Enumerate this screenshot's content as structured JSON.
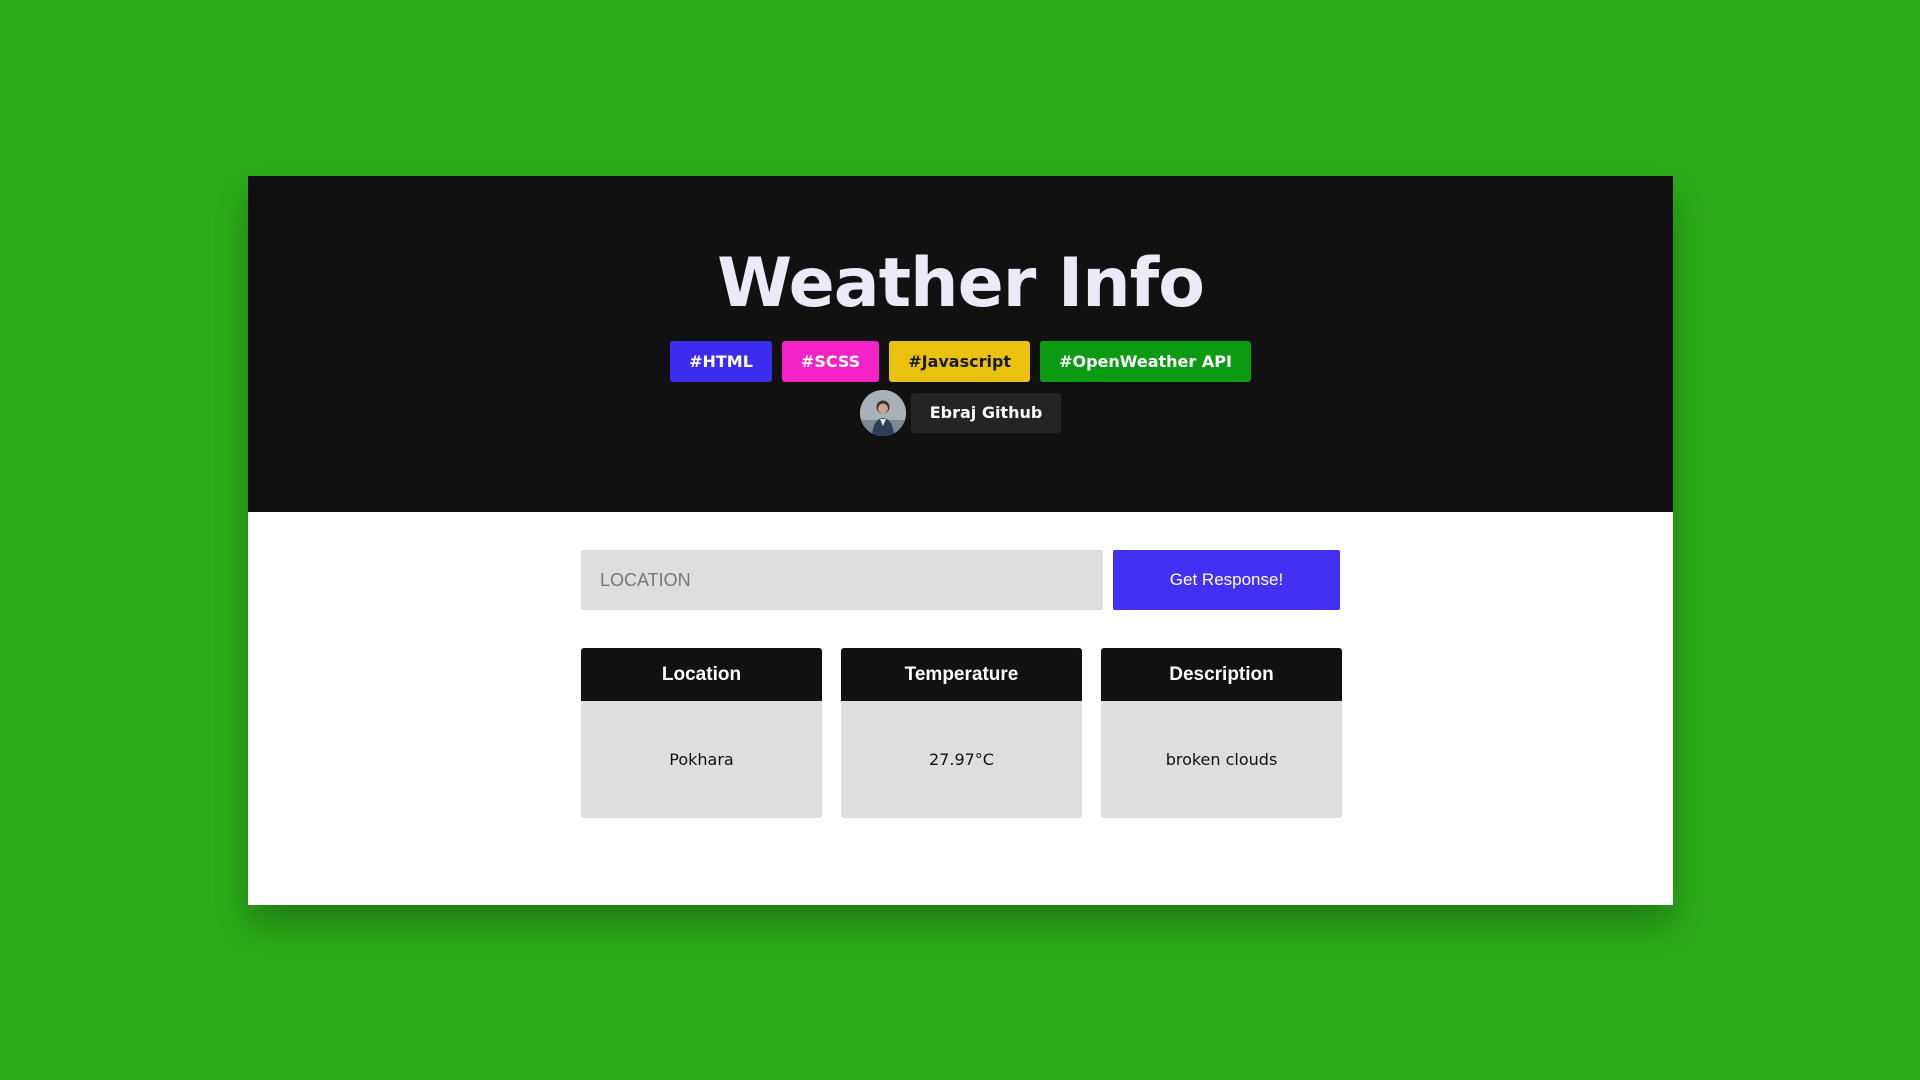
{
  "colors": {
    "page_background": "#2caa1a",
    "hero_background": "#111111",
    "tag_html": "#3b2cf0",
    "tag_scss": "#f522c8",
    "tag_javascript": "#ebc10f",
    "tag_openweather": "#0b9a12",
    "button": "#4331f3",
    "result_header": "#111111",
    "result_body": "#dedede"
  },
  "header": {
    "title": "Weather Info",
    "tags": [
      "#HTML",
      "#SCSS",
      "#Javascript",
      "#OpenWeather API"
    ],
    "github_label": "Ebraj Github"
  },
  "search": {
    "placeholder": "LOCATION",
    "value": "",
    "button_label": "Get Response!"
  },
  "results": [
    {
      "heading": "Location",
      "value": "Pokhara"
    },
    {
      "heading": "Temperature",
      "value": "27.97°C"
    },
    {
      "heading": "Description",
      "value": "broken clouds"
    }
  ]
}
